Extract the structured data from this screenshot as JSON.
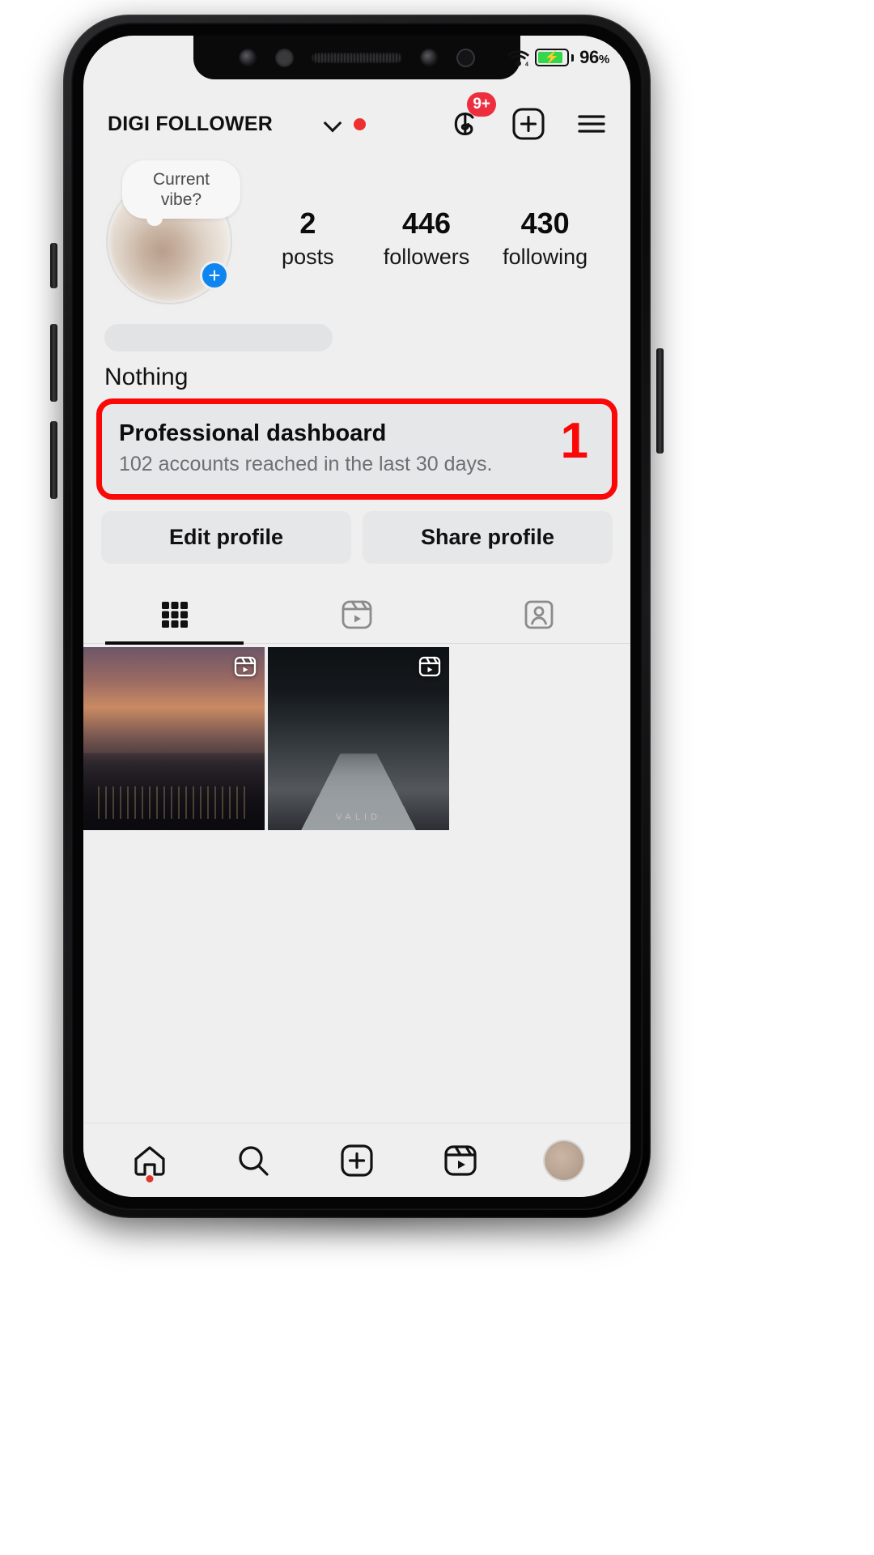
{
  "status_bar": {
    "wifi_icon": "wifi-icon",
    "battery_icon": "battery-charging-icon",
    "battery_percent": "96",
    "battery_percent_symbol": "%"
  },
  "header": {
    "username": "DIGI FOLLOWER",
    "chevron_icon": "chevron-down-icon",
    "status_dot": "red-dot-indicator",
    "threads_icon": "threads-icon",
    "threads_badge": "9+",
    "create_icon": "plus-square-icon",
    "menu_icon": "hamburger-menu-icon"
  },
  "profile": {
    "note_bubble": "Current vibe?",
    "avatar_icon": "profile-avatar",
    "add_story_label": "+",
    "stats": [
      {
        "value": "2",
        "label": "posts"
      },
      {
        "value": "446",
        "label": "followers"
      },
      {
        "value": "430",
        "label": "following"
      }
    ],
    "bio_name_placeholder": "",
    "bio_text": "Nothing"
  },
  "dashboard_card": {
    "title": "Professional dashboard",
    "subtitle": "102 accounts reached in the last 30 days.",
    "annotation_number": "1",
    "highlight_color": "#fa0808"
  },
  "actions": {
    "edit_profile": "Edit profile",
    "share_profile": "Share profile"
  },
  "tabs": [
    {
      "name": "grid-tab",
      "icon": "grid-icon",
      "active": true
    },
    {
      "name": "reels-tab",
      "icon": "reels-icon",
      "active": false
    },
    {
      "name": "tagged-tab",
      "icon": "tagged-person-icon",
      "active": false
    }
  ],
  "grid_posts": [
    {
      "name": "post-sunset-city",
      "badge_icon": "reel-clip-icon",
      "caption": ""
    },
    {
      "name": "post-pier-walkway",
      "badge_icon": "reel-clip-icon",
      "caption": "VALID"
    }
  ],
  "bottom_nav": [
    {
      "name": "nav-home",
      "icon": "home-icon",
      "active": true
    },
    {
      "name": "nav-search",
      "icon": "search-icon",
      "active": false
    },
    {
      "name": "nav-create",
      "icon": "plus-square-icon",
      "active": false
    },
    {
      "name": "nav-reels",
      "icon": "reels-icon",
      "active": false
    },
    {
      "name": "nav-profile",
      "icon": "avatar-icon",
      "active": false
    }
  ],
  "colors": {
    "accent_blue": "#0f86ef",
    "badge_red": "#ed2e3f",
    "annotation_red": "#fa0808",
    "screen_bg": "#efefef",
    "card_bg": "#e6e7e9"
  }
}
